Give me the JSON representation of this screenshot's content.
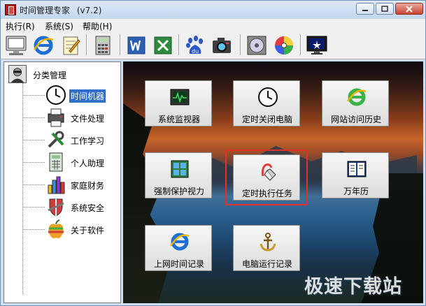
{
  "window": {
    "title": "时间管理专家",
    "version": "(v7.2)",
    "controls": [
      "minimize",
      "maximize",
      "close"
    ]
  },
  "menu": [
    {
      "label": "执行(R)"
    },
    {
      "label": "系统(S)"
    },
    {
      "label": "帮助(H)"
    }
  ],
  "toolbar": {
    "icons": [
      "monitor-icon",
      "ie-icon",
      "notepad-icon",
      "calculator-icon",
      "word-icon",
      "excel-icon",
      "baidu-icon",
      "camera-icon",
      "disc-icon",
      "color-disc-icon",
      "screen-icon"
    ]
  },
  "sidebar": {
    "root_label": "分类管理",
    "items": [
      {
        "label": "时间机器",
        "icon": "clock-icon",
        "selected": true
      },
      {
        "label": "文件处理",
        "icon": "printer-icon",
        "selected": false
      },
      {
        "label": "工作学习",
        "icon": "tools-icon",
        "selected": false
      },
      {
        "label": "个人助理",
        "icon": "calculator-icon",
        "selected": false
      },
      {
        "label": "家庭财务",
        "icon": "chart-icon",
        "selected": false
      },
      {
        "label": "系统安全",
        "icon": "shield-icon",
        "selected": false
      },
      {
        "label": "关于软件",
        "icon": "apple-icon",
        "selected": false
      }
    ]
  },
  "main": {
    "buttons": [
      {
        "label": "系统监视器",
        "icon": "oscilloscope-icon"
      },
      {
        "label": "定时关闭电脑",
        "icon": "clock-icon"
      },
      {
        "label": "网站访问历史",
        "icon": "ie-icon"
      },
      {
        "label": "强制保护视力",
        "icon": "eye-protect-icon"
      },
      {
        "label": "定时执行任务",
        "icon": "task-hand-icon"
      },
      {
        "label": "万年历",
        "icon": "calendar-book-icon"
      },
      {
        "label": "上网时间记录",
        "icon": "ie-icon"
      },
      {
        "label": "电脑运行记录",
        "icon": "anchor-icon"
      }
    ],
    "watermark": "极速下载站"
  }
}
